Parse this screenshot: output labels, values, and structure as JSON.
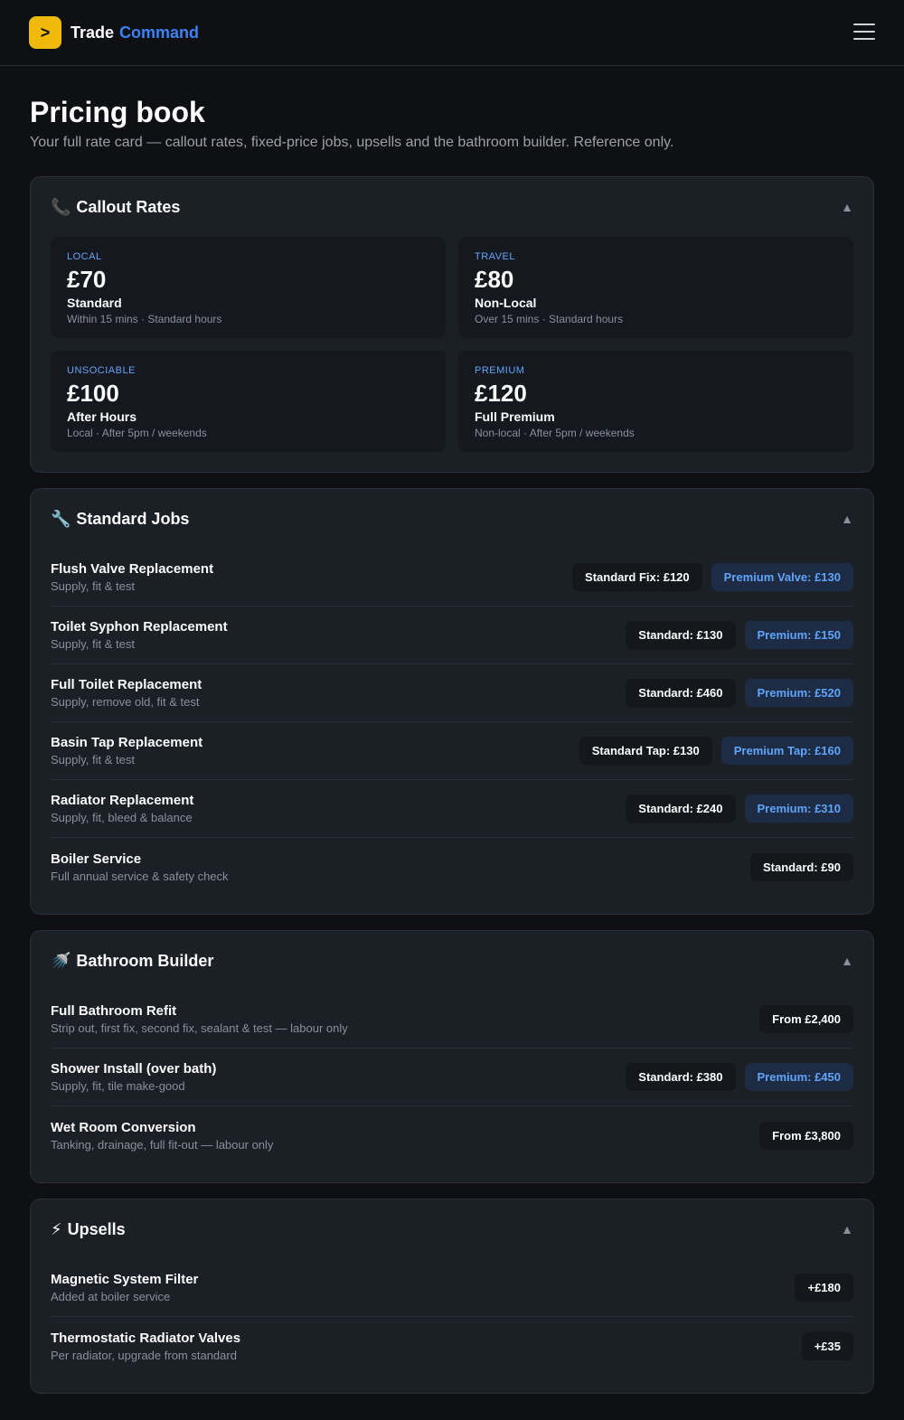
{
  "header": {
    "logo_glyph": ">",
    "brand_1": "Trade",
    "brand_2": "Command"
  },
  "page": {
    "title": "Pricing book",
    "subtitle": "Your full rate card — callout rates, fixed-price jobs, upsells and the bathroom builder. Reference only."
  },
  "callout": {
    "icon": "📞",
    "title": "Callout Rates",
    "caret": "▲",
    "cards": [
      {
        "tag": "LOCAL",
        "price": "£70",
        "name": "Standard",
        "desc": "Within 15 mins · Standard hours"
      },
      {
        "tag": "TRAVEL",
        "price": "£80",
        "name": "Non-Local",
        "desc": "Over 15 mins · Standard hours"
      },
      {
        "tag": "UNSOCIABLE",
        "price": "£100",
        "name": "After Hours",
        "desc": "Local · After 5pm / weekends"
      },
      {
        "tag": "PREMIUM",
        "price": "£120",
        "name": "Full Premium",
        "desc": "Non-local · After 5pm / weekends"
      }
    ]
  },
  "standard_jobs": {
    "icon": "🔧",
    "title": "Standard Jobs",
    "caret": "▲",
    "rows": [
      {
        "name": "Flush Valve Replacement",
        "desc": "Supply, fit & test",
        "std": "Standard Fix: £120",
        "prem": "Premium Valve: £130"
      },
      {
        "name": "Toilet Syphon Replacement",
        "desc": "Supply, fit & test",
        "std": "Standard: £130",
        "prem": "Premium: £150"
      },
      {
        "name": "Full Toilet Replacement",
        "desc": "Supply, remove old, fit & test",
        "std": "Standard: £460",
        "prem": "Premium: £520"
      },
      {
        "name": "Basin Tap Replacement",
        "desc": "Supply, fit & test",
        "std": "Standard Tap: £130",
        "prem": "Premium Tap: £160"
      },
      {
        "name": "Radiator Replacement",
        "desc": "Supply, fit, bleed & balance",
        "std": "Standard: £240",
        "prem": "Premium: £310"
      },
      {
        "name": "Boiler Service",
        "desc": "Full annual service & safety check",
        "std": "Standard: £90"
      }
    ]
  },
  "bathroom": {
    "icon": "🚿",
    "title": "Bathroom Builder",
    "caret": "▲",
    "rows": [
      {
        "name": "Full Bathroom Refit",
        "desc": "Strip out, first fix, second fix, sealant & test — labour only",
        "std": "From £2,400"
      },
      {
        "name": "Shower Install (over bath)",
        "desc": "Supply, fit, tile make-good",
        "std": "Standard: £380",
        "prem": "Premium: £450"
      },
      {
        "name": "Wet Room Conversion",
        "desc": "Tanking, drainage, full fit-out — labour only",
        "std": "From £3,800"
      }
    ]
  },
  "upsells": {
    "icon": "⚡",
    "title": "Upsells",
    "caret": "▲",
    "rows": [
      {
        "name": "Magnetic System Filter",
        "desc": "Added at boiler service",
        "std": "+£180"
      },
      {
        "name": "Thermostatic Radiator Valves",
        "desc": "Per radiator, upgrade from standard",
        "std": "+£35"
      }
    ]
  },
  "colors": {
    "accent": "#3b82f6",
    "logo": "#f0b90b",
    "premium_text": "#60a5fa",
    "background": "#0e1014",
    "card": "#1b1f26"
  }
}
